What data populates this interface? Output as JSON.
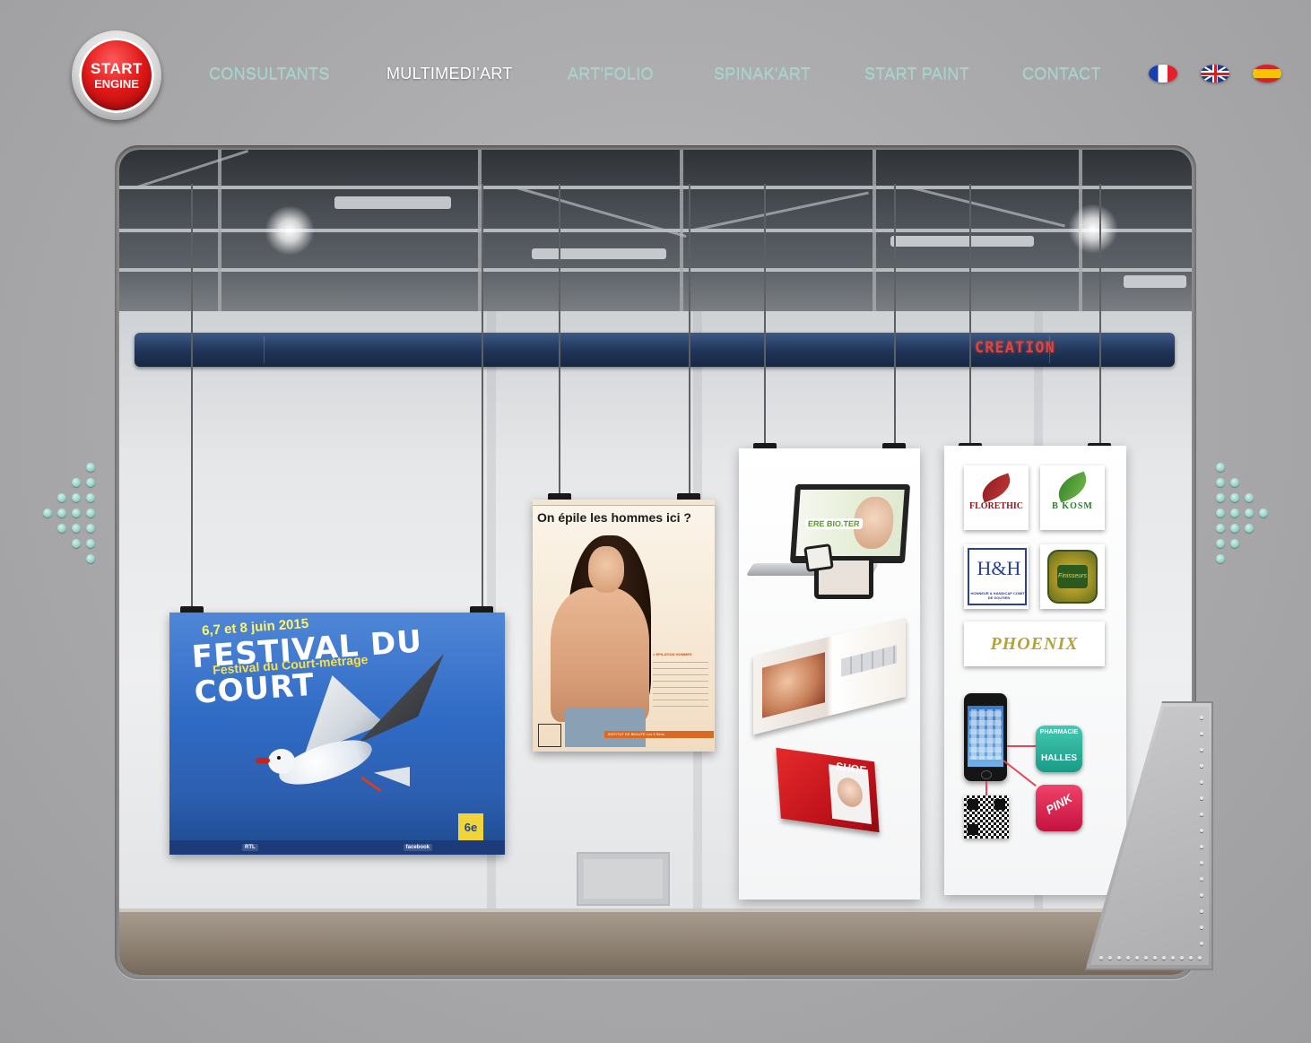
{
  "brand": {
    "line1": "START",
    "line2": "ENGINE",
    "registered": "®"
  },
  "nav": {
    "items": [
      {
        "label": "CONSULTANTS",
        "active": false
      },
      {
        "label": "MULTIMEDI'ART",
        "active": true
      },
      {
        "label": "ART'FOLIO",
        "active": false
      },
      {
        "label": "SPINAK'ART",
        "active": false
      },
      {
        "label": "START PAINT",
        "active": false
      },
      {
        "label": "CONTACT",
        "active": false
      }
    ],
    "languages": [
      "french-flag-icon",
      "uk-flag-icon",
      "spain-flag-icon"
    ]
  },
  "gallery": {
    "rail_label": "CREATION",
    "festival_poster": {
      "date": "6,7 et 8 juin 2015",
      "title": "FESTIVAL DU COURT",
      "subtitle": "Festival du Court-métrage",
      "badge": "6e",
      "footer_logos": [
        "RTL",
        "facebook"
      ]
    },
    "epile_poster": {
      "title": "On épile les hommes ici ?",
      "price_heading": "> EPILATION HOMMES",
      "logo": "les 5 sens",
      "footer": "INSTITUT DE BEAUTE Les 5 Sens"
    },
    "web_panel": {
      "laptop_logo": "ERE BIO.TER",
      "magazine_title": "SHOE",
      "magazine_sub": "PINKSHOE"
    },
    "brand_panel": {
      "tiles": [
        "FLORETHIC",
        "B KOSM",
        "H&H",
        "PHOENIX"
      ],
      "hh_sub": "HONNEUR & HANDICAP COMITE DE SOUTIEN",
      "fin_label": "Finisseurs",
      "apps": {
        "pharmacie_top": "PHARMACIE",
        "pharmacie_bottom": "HALLES",
        "pink": "PINK"
      }
    }
  },
  "colors": {
    "nav_inactive": "#9fd7cf",
    "nav_active": "#ffffff",
    "logo_red": "#e01818",
    "rail_blue": "#22365a",
    "rail_text": "#e0433a"
  }
}
